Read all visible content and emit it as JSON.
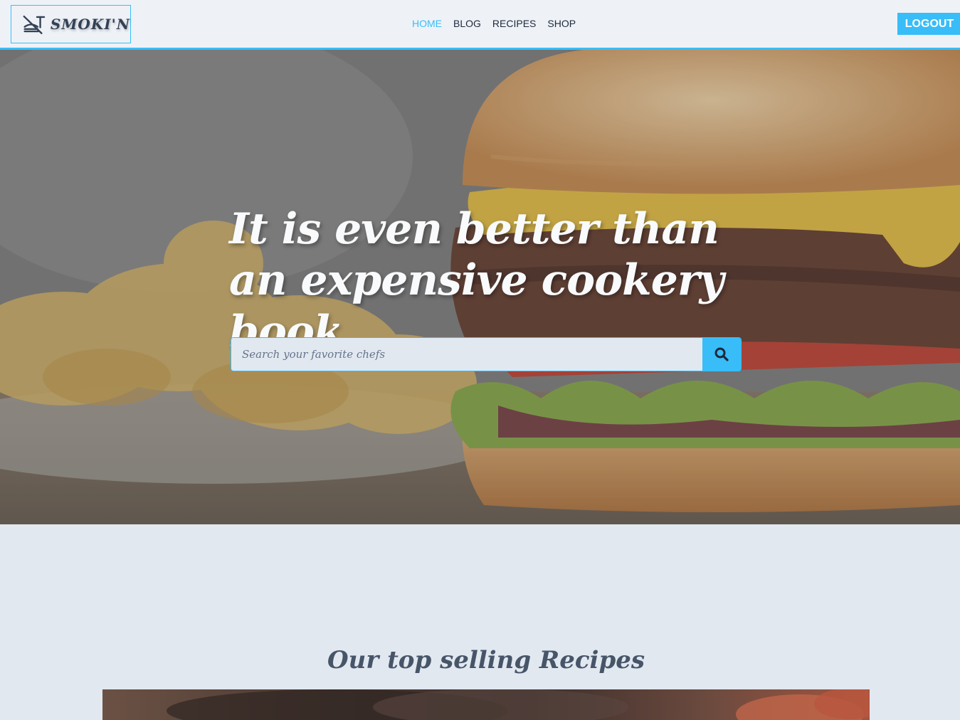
{
  "header": {
    "logo_text": "SMOKI'N",
    "logo_icon": "no-food-icon",
    "nav": [
      {
        "label": "HOME",
        "active": true
      },
      {
        "label": "BLOG",
        "active": false
      },
      {
        "label": "RECIPES",
        "active": false
      },
      {
        "label": "SHOP",
        "active": false
      }
    ],
    "logout_label": "LOGOUT"
  },
  "hero": {
    "title": "It is even better than an expensive cookery book",
    "search_placeholder": "Search your favorite chefs",
    "search_icon": "search-icon"
  },
  "section": {
    "title": "Our top selling Recipes"
  },
  "colors": {
    "accent": "#38bdf8",
    "text_dark": "#1e293b",
    "heading": "#475569",
    "page_bg": "#e2e8f0"
  }
}
